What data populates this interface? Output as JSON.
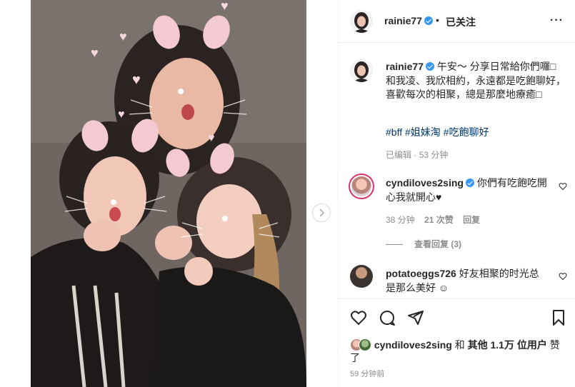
{
  "post": {
    "image_alt": "Three women taking a selfie with bunny-ear face filters",
    "carousel_next_icon": "chevron-right-icon"
  },
  "header": {
    "username": "rainie77",
    "separator": "•",
    "follow_status": "已关注",
    "more_label": "···"
  },
  "caption": {
    "username": "rainie77",
    "text_line1": "午安～",
    "text_body": "分享日常給你們囉□和我凌、我欣相約，永遠都是吃飽聊好，喜歡每次的相聚，總是那麼地療癒□",
    "hashtags": "#bff #姐妹淘 #吃飽聊好",
    "edited": "已编辑",
    "dot": "·",
    "time": "53 分钟"
  },
  "comments": [
    {
      "username": "cyndiloves2sing",
      "text": "你們有吃飽吃開心我就開心♥",
      "time": "38 分钟",
      "likes": "21 次赞",
      "reply_label": "回复"
    },
    {
      "username": "potatoeggs726",
      "text": "好友相聚的时光总是那么美好 ☺"
    }
  ],
  "view_replies": "查看回复 (3)",
  "likes": {
    "lead_user": "cyndiloves2sing",
    "connector": "和",
    "others": "其他",
    "count": "1.1万",
    "unit": "位用户",
    "suffix": "赞了"
  },
  "post_time": "59 分钟前",
  "colors": {
    "verified": "#3897f0",
    "link": "#00376b",
    "muted": "#8e8e8e",
    "story_ring": "#e1306c"
  }
}
